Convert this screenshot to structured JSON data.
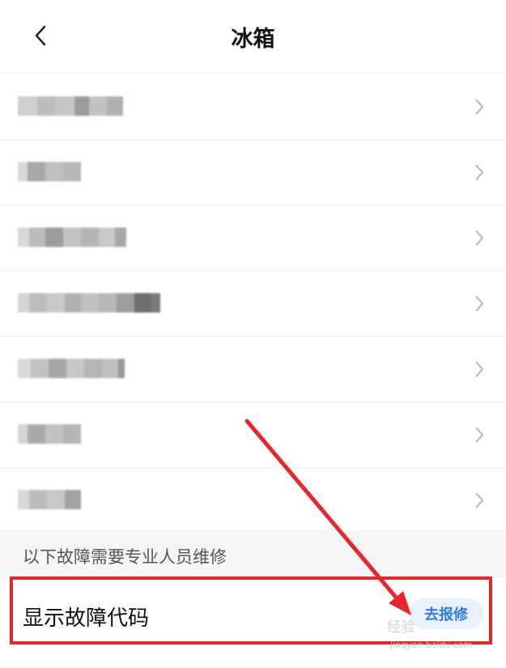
{
  "header": {
    "title": "冰箱",
    "back_icon": "chevron-left-icon"
  },
  "list": {
    "item_count": 7,
    "chevron_icon": "chevron-right-icon",
    "items_note": "item labels are pixelated/obscured in the screenshot"
  },
  "section_note": "以下故障需要专业人员维修",
  "fault_row": {
    "label": "显示故障代码",
    "button_label": "去报修"
  },
  "annotation": {
    "highlight_color": "#e8262b"
  },
  "watermark": {
    "text": "经验",
    "sub": "jingyan.baidu.com"
  },
  "colors": {
    "accent": "#2f7be6",
    "accent_bg": "#e9f1fc",
    "divider": "#eeeeee",
    "section_bg": "#f5f5f7"
  }
}
